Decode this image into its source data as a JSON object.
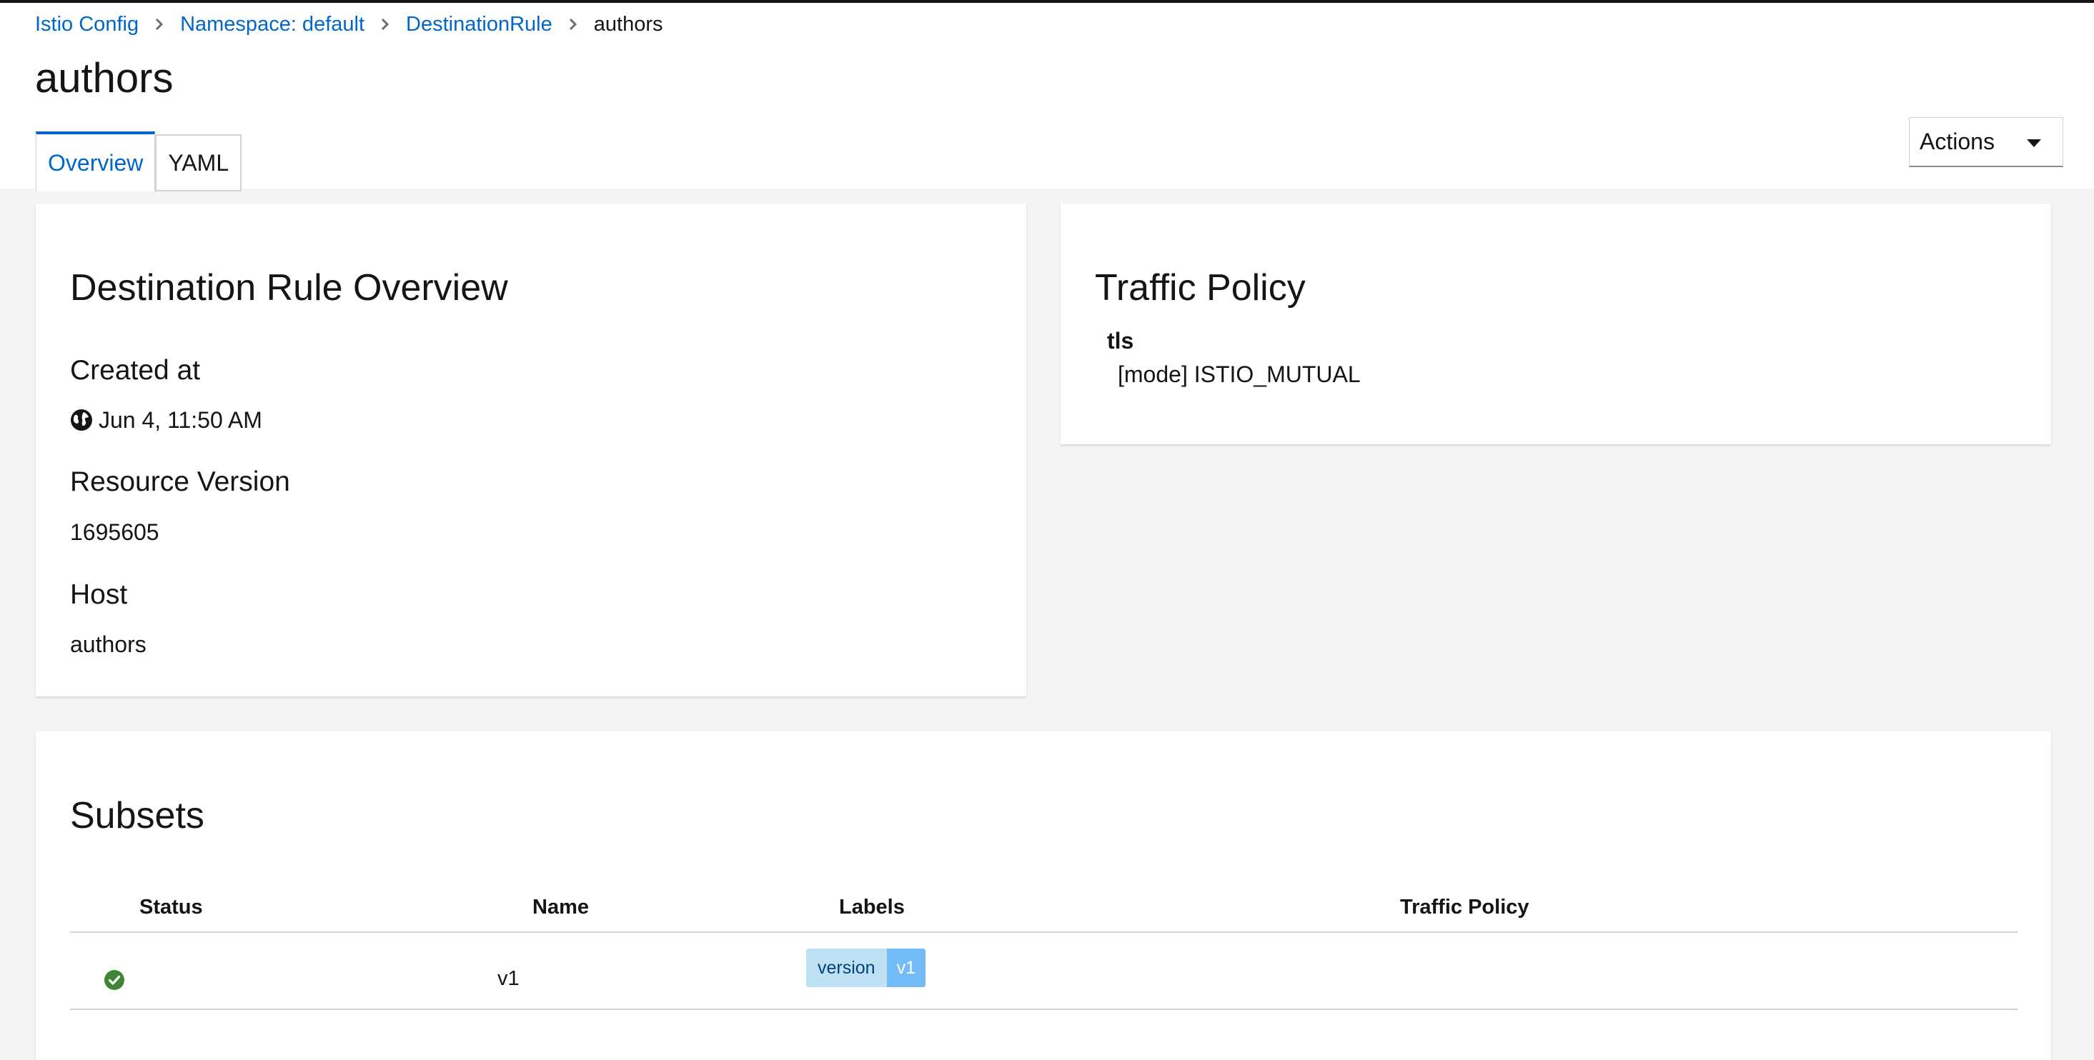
{
  "breadcrumb": {
    "items": [
      "Istio Config",
      "Namespace: default",
      "DestinationRule"
    ],
    "current": "authors"
  },
  "page": {
    "title": "authors"
  },
  "tabs": [
    {
      "label": "Overview",
      "active": true
    },
    {
      "label": "YAML",
      "active": false
    }
  ],
  "actions": {
    "label": "Actions"
  },
  "overview": {
    "title": "Destination Rule Overview",
    "created_label": "Created at",
    "created_value": "Jun 4, 11:50 AM",
    "version_label": "Resource Version",
    "version_value": "1695605",
    "host_label": "Host",
    "host_value": "authors"
  },
  "traffic_policy": {
    "title": "Traffic Policy",
    "key": "tls",
    "value": "[mode] ISTIO_MUTUAL"
  },
  "subsets": {
    "title": "Subsets",
    "columns": [
      "Status",
      "Name",
      "Labels",
      "Traffic Policy"
    ],
    "rows": [
      {
        "status": "ok",
        "name": "v1",
        "label_key": "version",
        "label_value": "v1",
        "traffic_policy": ""
      }
    ]
  },
  "colors": {
    "link": "#0066cc",
    "ok": "#3e8635",
    "label_key_bg": "#bee1f4",
    "label_value_bg": "#73bcf7"
  }
}
